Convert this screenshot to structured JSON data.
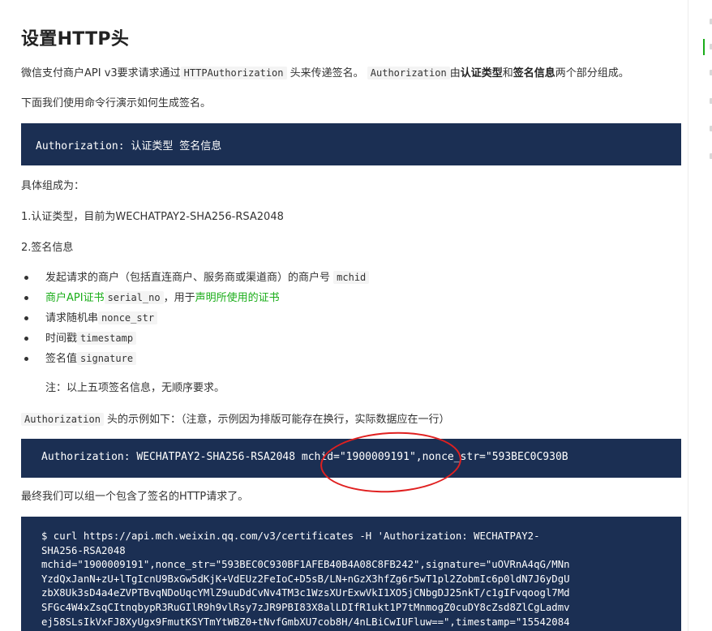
{
  "title": "设置HTTP头",
  "intro": {
    "prefix": "微信支付商户API v3要求请求通过",
    "code1": "HTTPAuthorization",
    "middle": " 头来传递签名。 ",
    "code2": "Authorization",
    "after": "由",
    "bold1": "认证类型",
    "and": "和",
    "bold2": "签名信息",
    "suffix": "两个部分组成。"
  },
  "demo_text": "下面我们使用命令行演示如何生成签名。",
  "code_header": "Authorization: 认证类型 签名信息",
  "composition_label": "具体组成为：",
  "item1": "1.认证类型，目前为WECHATPAY2-SHA256-RSA2048",
  "item2": "2.签名信息",
  "bullets": {
    "b1_text": "发起请求的商户（包括直连商户、服务商或渠道商）的商户号 ",
    "b1_code": "mchid",
    "b2_link1": "商户API证书",
    "b2_code": "serial_no",
    "b2_mid": "，用于",
    "b2_link2": "声明所使用的证书",
    "b3_text": "请求随机串",
    "b3_code": "nonce_str",
    "b4_text": "时间戳",
    "b4_code": "timestamp",
    "b5_text": "签名值",
    "b5_code": "signature"
  },
  "note": "注：以上五项签名信息，无顺序要求。",
  "example": {
    "code": "Authorization",
    "text": " 头的示例如下：（注意，示例因为排版可能存在换行，实际数据应在一行）"
  },
  "example_code": "Authorization: WECHATPAY2-SHA256-RSA2048 mchid=\"1900009191\",nonce_str=\"593BEC0C930B",
  "final_text": "最终我们可以组一个包含了签名的HTTP请求了。",
  "curl_lines": [
    "$ curl https://api.mch.weixin.qq.com/v3/certificates -H 'Authorization: WECHATPAY2-",
    "SHA256-RSA2048",
    "mchid=\"1900009191\",nonce_str=\"593BEC0C930BF1AFEB40B4A08C8FB242\",signature=\"uOVRnA4qG/MNn",
    "YzdQxJanN+zU+lTgIcnU9BxGw5dKjK+VdEUz2FeIoC+D5sB/LN+nGzX3hfZg6r5wT1pl2ZobmIc6p0ldN7J6yDgU",
    "zbX8Uk3sD4a4eZVPTBvqNDoUqcYMlZ9uuDdCvNv4TM3c1WzsXUrExwVkI1XO5jCNbgDJ25nkT/c1gIFvqoogl7Md",
    "SFGc4W4xZsqCItnqbypR3RuGIlR9h9vlRsy7zJR9PBI83X8alLDIfR1ukt1P7tMnmogZ0cuDY8cZsd8ZlCgLadmv",
    "ej58SLsIkVxFJ8XyUgx9FmutKSYTmYtWBZ0+tNvfGmbXU7cob8H/4nLBiCwIUFluw==\",timestamp=\"15542084"
  ]
}
